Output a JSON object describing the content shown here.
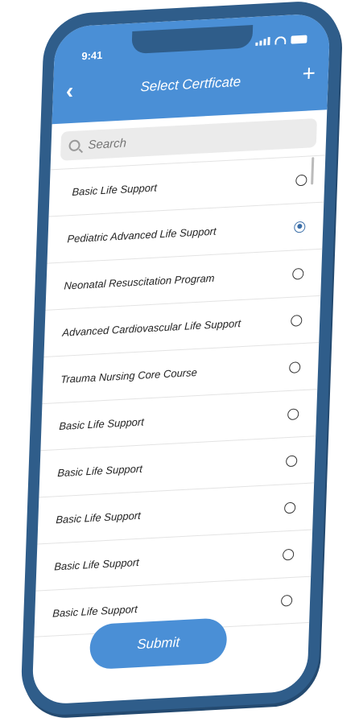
{
  "status_bar": {
    "time": "9:41"
  },
  "header": {
    "title": "Select Certficate",
    "back_icon": "chevron-left-icon",
    "add_icon": "plus-icon"
  },
  "search": {
    "placeholder": "Search"
  },
  "list": {
    "items": [
      {
        "label": "Basic Life Support",
        "selected": false
      },
      {
        "label": "Pediatric Advanced Life Support",
        "selected": true
      },
      {
        "label": "Neonatal Resuscitation Program",
        "selected": false
      },
      {
        "label": "Advanced Cardiovascular Life Support",
        "selected": false
      },
      {
        "label": "Trauma Nursing Core Course",
        "selected": false
      },
      {
        "label": "Basic Life Support",
        "selected": false
      },
      {
        "label": "Basic Life Support",
        "selected": false
      },
      {
        "label": "Basic Life Support",
        "selected": false
      },
      {
        "label": "Basic Life Support",
        "selected": false
      },
      {
        "label": "Basic Life Support",
        "selected": false
      }
    ]
  },
  "footer": {
    "submit_label": "Submit"
  },
  "colors": {
    "accent": "#4a8fd6",
    "frame": "#2f5d8a",
    "radio_selected": "#3a6ea8"
  }
}
